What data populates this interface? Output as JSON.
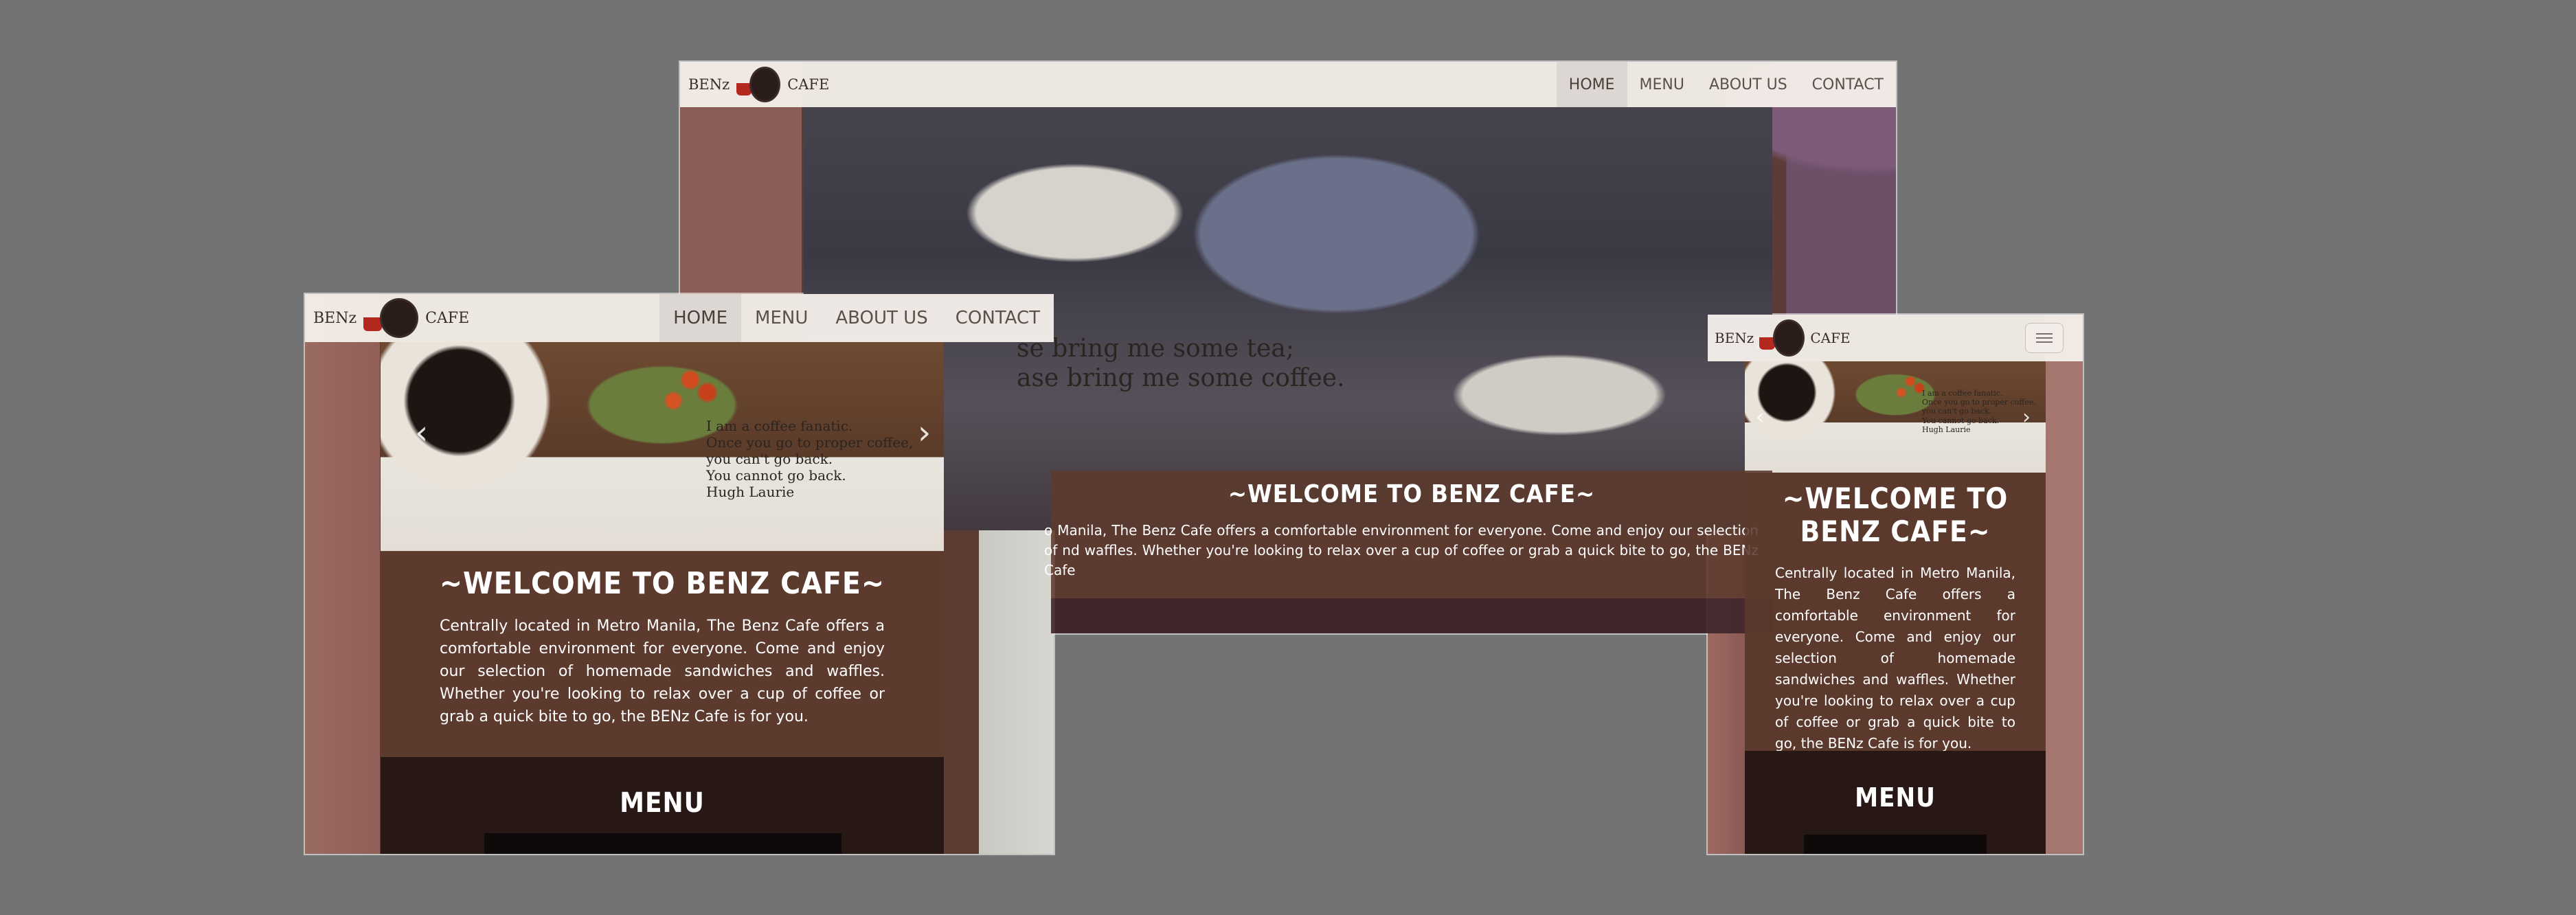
{
  "brand": {
    "name_left": "BENz",
    "name_right": "CAFE"
  },
  "nav": {
    "items": [
      "HOME",
      "MENU",
      "ABOUT US",
      "CONTACT"
    ],
    "active": "HOME"
  },
  "desktop": {
    "quote_lines": [
      "se bring me some tea;",
      "ase bring me some coffee."
    ],
    "welcome_title": "~WELCOME TO BENZ CAFE~",
    "welcome_text": "o Manila, The Benz Cafe offers a comfortable environment for everyone. Come and enjoy our selection of nd waffles. Whether you're looking to relax over a cup of coffee or grab a quick bite to go, the BENz Cafe"
  },
  "tablet": {
    "quote_lines": [
      "I am a coffee fanatic.",
      "Once you go to proper coffee,",
      "you can't go back.",
      "You cannot go back.",
      "Hugh Laurie"
    ],
    "welcome_title": "~WELCOME TO BENZ CAFE~",
    "welcome_text": "Centrally located in Metro Manila, The Benz Cafe offers a comfortable environment for everyone. Come and enjoy our selection of homemade sandwiches and waffles. Whether you're looking to relax over a cup of coffee or grab a quick bite to go, the BENz Cafe is for you.",
    "menu_title": "MENU"
  },
  "phone": {
    "quote_lines": [
      "I am a coffee fanatic.",
      "Once you go to proper coffee,",
      "you can't go back.",
      "You cannot go back.",
      "Hugh Laurie"
    ],
    "welcome_title": "~WELCOME TO BENZ CAFE~",
    "welcome_text": "Centrally located in Metro Manila, The Benz Cafe offers a comfortable environment for everyone. Come and enjoy our selection of homemade sandwiches and waffles. Whether you're looking to relax over a cup of coffee or grab a quick bite to go, the BENz Cafe is for you.",
    "menu_title": "MENU"
  },
  "icons": {
    "prev": "‹",
    "next": "›"
  },
  "colors": {
    "page_background": "#737373",
    "navbar": "#f4eee9",
    "accent": "#b5281f"
  }
}
